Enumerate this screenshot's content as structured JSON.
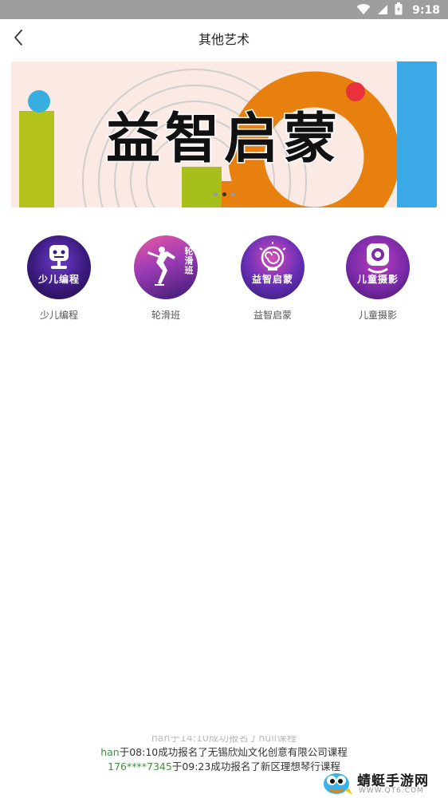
{
  "status_bar": {
    "time": "9:18",
    "icons": [
      "wifi-icon",
      "signal-icon",
      "battery-icon"
    ]
  },
  "header": {
    "title": "其他艺术",
    "back_icon": "chevron-left-icon"
  },
  "banner": {
    "title": "益智启蒙",
    "dots_count": 3,
    "active_dot": 1
  },
  "categories": [
    {
      "label": "少儿编程",
      "circle_text": "少儿编程",
      "icon": "robot-icon"
    },
    {
      "label": "轮滑班",
      "circle_text": "轮滑班",
      "icon": "skater-icon"
    },
    {
      "label": "益智启蒙",
      "circle_text": "益智启蒙",
      "icon": "lightbulb-icon"
    },
    {
      "label": "儿童摄影",
      "circle_text": "儿童摄影",
      "icon": "camera-icon"
    }
  ],
  "marquee": {
    "line0": "han于14:10成功报名了null课程",
    "line1_user": "han",
    "line1_rest": "于08:10成功报名了无锡欣灿文化创意有限公司课程",
    "line2_user": "176****7345",
    "line2_rest": "于09:23成功报名了新区理想琴行课程"
  },
  "watermark": {
    "name": "蜻蜓手游网",
    "url": "WWW.QT6.COM"
  },
  "colors": {
    "status_bar": "#9e9e9e",
    "highlight_user": "#3f8f3f"
  }
}
